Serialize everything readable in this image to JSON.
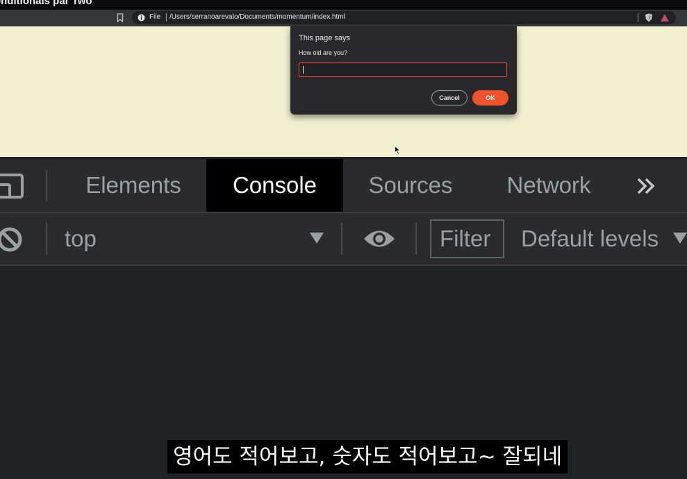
{
  "video": {
    "title": "onditionals par Two"
  },
  "browser": {
    "scheme_label": "File",
    "url": "/Users/serranoarevalo/Documents/momentum/index.html"
  },
  "dialog": {
    "title": "This page says",
    "message": "How old are you?",
    "input_value": "",
    "cancel_label": "Cancel",
    "ok_label": "OK",
    "accent_color": "#f0532c"
  },
  "devtools": {
    "tabs": [
      {
        "label": "Elements",
        "active": false
      },
      {
        "label": "Console",
        "active": true
      },
      {
        "label": "Sources",
        "active": false
      },
      {
        "label": "Network",
        "active": false
      }
    ],
    "more_tabs_label": "»",
    "console": {
      "context": "top",
      "filter_placeholder": "Filter",
      "levels_label": "Default levels"
    }
  },
  "subtitle": {
    "text": "영어도 적어보고, 숫자도 적어보고~ 잘되네"
  }
}
